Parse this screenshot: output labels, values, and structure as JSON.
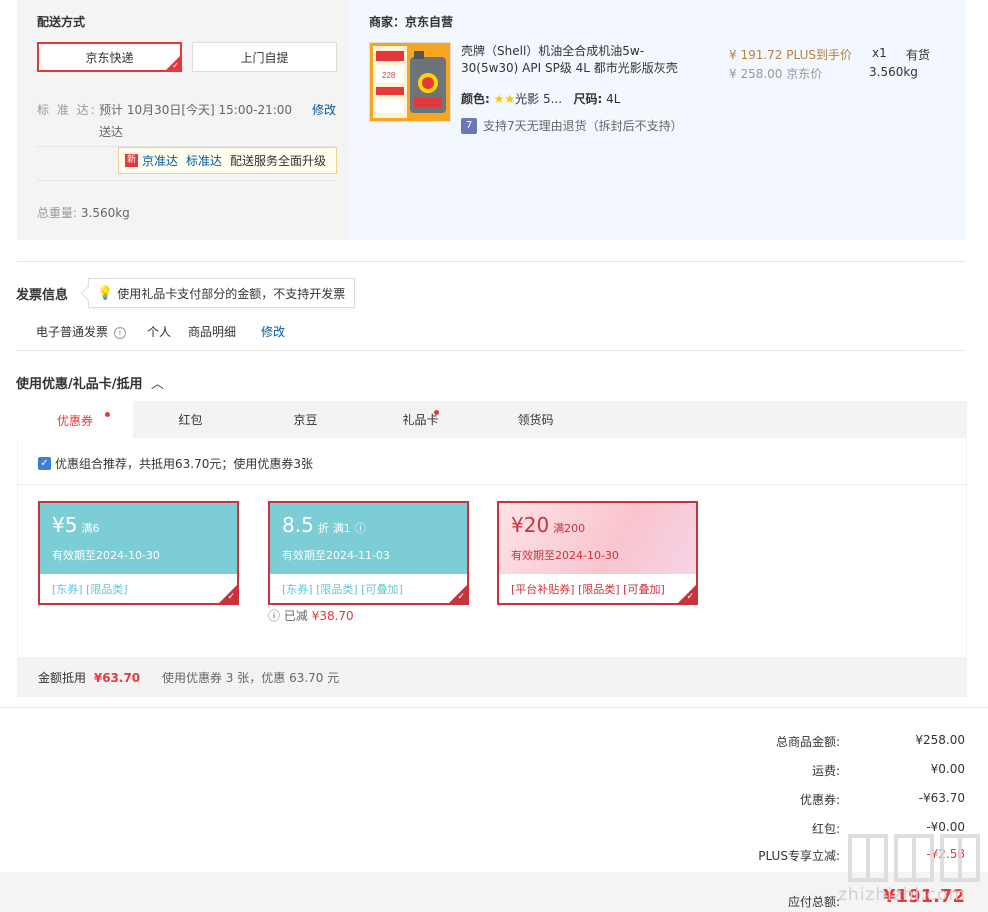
{
  "shipping": {
    "title": "配送方式",
    "options": [
      "京东快递",
      "上门自提"
    ],
    "selected": "京东快递",
    "standard_label": "标 准 达:",
    "standard_time": "预计 10月30日[今天] 15:00-21:00 送达",
    "modify": "修改",
    "upgrade_badge": "新",
    "upgrade_tip_1": "京准达",
    "upgrade_tip_2": "标准达",
    "upgrade_tip_3": "配送服务全面升级",
    "weight_label": "总重量:",
    "weight_value": "3.560kg"
  },
  "product": {
    "merchant": "商家：京东自营",
    "name": "壳牌（Shell）机油全合成机油5w-30(5w30) API SP级 4L 都市光影版灰壳",
    "color_label": "颜色:",
    "color_value": "光影 5...",
    "size_label": "尺码:",
    "size_value": "4L",
    "return_badge": "7",
    "return_text": "支持7天无理由退货（拆封后不支持）",
    "plus_price": "¥ 191.72 PLUS到手价",
    "jd_price": "¥ 258.00 京东价",
    "qty": "x1",
    "stock": "有货",
    "weight": "3.560kg",
    "image_badge": "228"
  },
  "invoice": {
    "title": "发票信息",
    "tip": "使用礼品卡支付部分的金额，不支持开发票",
    "type": "电子普通发票",
    "info_icon": "i",
    "owner": "个人",
    "content": "商品明细",
    "modify": "修改"
  },
  "coupons": {
    "title": "使用优惠/礼品卡/抵用",
    "tabs": [
      "优惠券",
      "红包",
      "京豆",
      "礼品卡",
      "领货码"
    ],
    "combo_text": "优惠组合推荐，共抵用63.70元；使用优惠券3张",
    "cards": [
      {
        "amount": "¥5",
        "cond": "满6",
        "expire": "有效期至2024-10-30",
        "tags": "[东券]  [限品类]"
      },
      {
        "amount": "8.5",
        "unit": "折",
        "cond": "满1",
        "expire": "有效期至2024-11-03",
        "tags": "[东券]  [限品类]  [可叠加]"
      },
      {
        "amount": "¥20",
        "cond": "满200",
        "expire": "有效期至2024-10-30",
        "tags": "[平台补贴券]  [限品类]  [可叠加]"
      }
    ],
    "already_label": "已减",
    "already_value": "¥38.70",
    "offset_label": "金额抵用",
    "offset_amount": "¥63.70",
    "offset_desc": "使用优惠券 3 张，优惠 63.70 元"
  },
  "summary": {
    "rows": [
      {
        "label": "总商品金额:",
        "value": "¥258.00"
      },
      {
        "label": "运费:",
        "value": "¥0.00"
      },
      {
        "label": "优惠券:",
        "value": "-¥63.70"
      },
      {
        "label": "红包:",
        "value": "-¥0.00"
      },
      {
        "label": "PLUS专享立减:",
        "value": "-¥2.58"
      }
    ],
    "total_label": "应付总额:",
    "total_value": "¥191.72"
  },
  "watermark": "zhizhizhi.com",
  "colors": {
    "accent": "#e4393c",
    "link": "#005aa0",
    "teal": "#7ccdd6",
    "plus": "#b8823d"
  }
}
